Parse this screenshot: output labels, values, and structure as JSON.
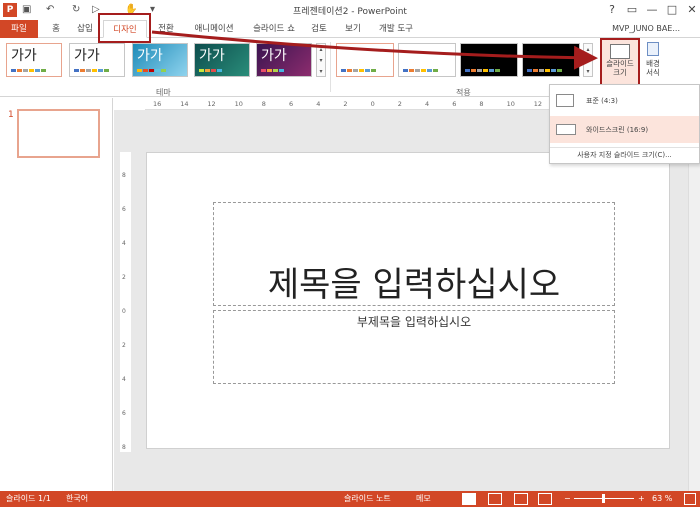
{
  "titlebar": {
    "title": "프레젠테이션2 - PowerPoint",
    "app_icon_letter": "P",
    "help": "?",
    "restore": "▭",
    "minimize": "—",
    "maximize": "□",
    "close": "✕"
  },
  "tabs": [
    "파일",
    "홈",
    "삽입",
    "디자인",
    "전환",
    "애니메이션",
    "슬라이드 쇼",
    "검토",
    "보기",
    "개발 도구"
  ],
  "user_name": "MVP_JUNO BAE...",
  "ribbon": {
    "theme_sample": "가가",
    "theme_group_label": "테마",
    "variant_group_label": "적용",
    "slide_size_label": "슬라이드 크기",
    "bg_format_label": "배경 서식"
  },
  "size_menu": {
    "standard": "표준 (4:3)",
    "widescreen": "와이드스크린 (16:9)",
    "custom": "사용자 지정 슬라이드 크기(C)..."
  },
  "ruler_h": [
    "16",
    "14",
    "12",
    "10",
    "8",
    "6",
    "4",
    "2",
    "0",
    "2",
    "4",
    "6",
    "8",
    "10",
    "12",
    "14",
    "16"
  ],
  "ruler_v": [
    "8",
    "6",
    "4",
    "2",
    "0",
    "2",
    "4",
    "6",
    "8"
  ],
  "thumbnails": {
    "slide_number": "1"
  },
  "slide": {
    "title_placeholder": "제목을 입력하십시오",
    "subtitle_placeholder": "부제목을 입력하십시오"
  },
  "statusbar": {
    "slide_count": "슬라이드 1/1",
    "language": "한국어",
    "notes": "슬라이드 노트",
    "comments": "메모",
    "zoom_percent": "63 %",
    "zoom_minus": "−",
    "zoom_plus": "+"
  },
  "colors": {
    "accent": "#d24726",
    "annotation_red": "#a51d1d"
  }
}
